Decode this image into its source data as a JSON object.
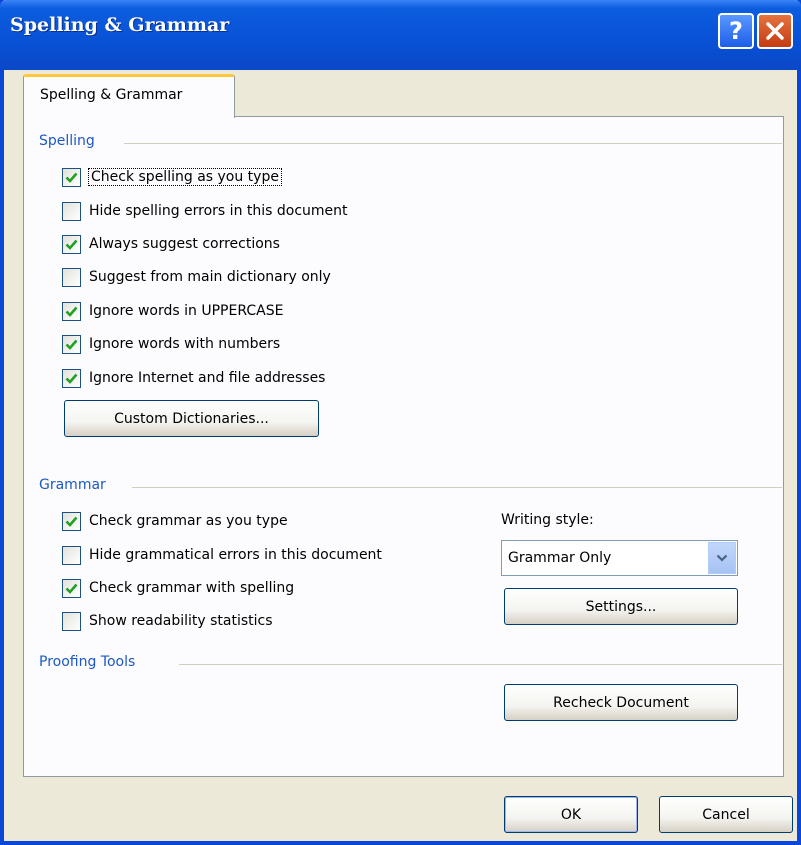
{
  "window": {
    "title": "Spelling & Grammar"
  },
  "tabs": [
    {
      "label": "Spelling & Grammar"
    }
  ],
  "spelling": {
    "heading": "Spelling",
    "options": [
      {
        "label": "Check spelling as you type",
        "checked": true
      },
      {
        "label": "Hide spelling errors in this document",
        "checked": false
      },
      {
        "label": "Always suggest corrections",
        "checked": true
      },
      {
        "label": "Suggest from main dictionary only",
        "checked": false
      },
      {
        "label": "Ignore words in UPPERCASE",
        "checked": true
      },
      {
        "label": "Ignore words with numbers",
        "checked": true
      },
      {
        "label": "Ignore Internet and file addresses",
        "checked": true
      }
    ],
    "custom_dictionaries_label": "Custom Dictionaries..."
  },
  "grammar": {
    "heading": "Grammar",
    "options": [
      {
        "label": "Check grammar as you type",
        "checked": true
      },
      {
        "label": "Hide grammatical errors in this document",
        "checked": false
      },
      {
        "label": "Check grammar with spelling",
        "checked": true
      },
      {
        "label": "Show readability statistics",
        "checked": false
      }
    ],
    "writing_style_label": "Writing style:",
    "writing_style_value": "Grammar Only",
    "settings_label": "Settings..."
  },
  "proofing": {
    "heading": "Proofing Tools",
    "recheck_label": "Recheck Document"
  },
  "footer": {
    "ok_label": "OK",
    "cancel_label": "Cancel"
  },
  "icons": {
    "help": "help-icon",
    "close": "close-icon",
    "check": "checkmark-icon",
    "dropdown": "chevron-down-icon"
  },
  "colors": {
    "titlebar": "#0852d6",
    "group_heading": "#1c59c4",
    "check": "#21a121",
    "dialog_bg": "#ece9d8",
    "tab_highlight": "#ffc83c"
  }
}
